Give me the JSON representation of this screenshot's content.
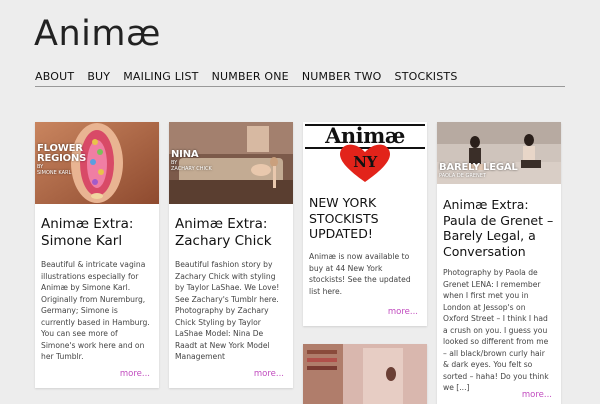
{
  "site": {
    "title": "Animæ"
  },
  "nav": {
    "items": [
      "ABOUT",
      "BUY",
      "MAILING LIST",
      "NUMBER ONE",
      "NUMBER TWO",
      "STOCKISTS"
    ]
  },
  "posts": [
    {
      "thumb_caption": [
        "FLOWER",
        "REGIONS",
        "BY",
        "SIMONE KARL"
      ],
      "title": "Animæ Extra: Simone Karl",
      "excerpt": "Beautiful & intricate vagina illustrations especially for Animæ by Simone Karl. Originally from Nuremburg, Germany; Simone is currently based in Hamburg. You can see more of Simone's work here and on her Tumblr.",
      "more": "more..."
    },
    {
      "thumb_caption": [
        "NINA",
        "BY",
        "ZACHARY CHICK"
      ],
      "title": "Animæ Extra: Zachary Chick",
      "excerpt": "Beautiful fashion story by Zachary Chick with styling by Taylor LaShae. We Love! See Zachary's Tumblr here. Photography by Zachary Chick Styling by Taylor LaShae Model: Nina De Raadt at New York Model Management",
      "more": "more..."
    },
    {
      "logo_word": "Animæ",
      "logo_city": "NY",
      "title": "NEW YORK STOCKISTS UPDATED!",
      "excerpt": "Animæ is now available to buy at 44 New York stockists! See the updated list here.",
      "more": "more..."
    },
    {
      "thumb_caption": [
        "BARELY LEGAL",
        "BY",
        "PAOLA DE GRENET"
      ],
      "title": "Animæ Extra: Paula de Grenet – Barely Legal, a Conversation",
      "excerpt": "Photography by Paola de Grenet LENA: I remember when I first met you in London at Jessop's on Oxford Street – I think I had a crush on you. I guess you looked so different from me – all black/brown curly hair & dark eyes. You felt so sorted – haha! Do you think we [...]",
      "more": "more..."
    }
  ]
}
